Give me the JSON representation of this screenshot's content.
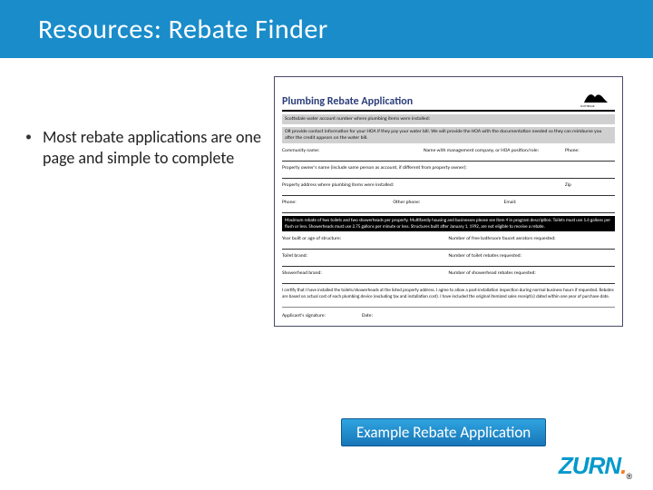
{
  "title": "Resources:  Rebate Finder",
  "bullet": "Most rebate applications are one page and simple to complete",
  "form": {
    "logo_city": "CITY OF SCOTTSDALE",
    "heading": "Plumbing Rebate Application",
    "band1": "Scottsdale water account number where plumbing items were installed:",
    "band2": "OR provide contact information for your HOA if they pay your water bill. We will provide the HOA with the documentation needed so they can reimburse you after the credit appears on the water bill.",
    "row1": {
      "a": "Community name:",
      "b": "Name with management company, or HOA position/role:",
      "c": "Phone:"
    },
    "row2": "Property owner's name (include same person as account, if different from property owner):",
    "row3": {
      "a": "Property address where plumbing items were installed:",
      "b": "Zip"
    },
    "row4": {
      "a": "Phone:",
      "b": "Other phone:",
      "c": "Email:"
    },
    "band3": "Maximum rebate of two toilets and two showerheads per property. Multifamily housing and businesses please see item 4 in program description. Toilets must use 1.6 gallons per flush or less. Showerheads must use 2.75 gallons per minute or less. Structures built after January 1, 1992, are not eligible to receive a rebate.",
    "row5": {
      "a": "Year built or age of structure:",
      "b": "Number of free bathroom faucet aerators requested:"
    },
    "row6": {
      "a": "Toilet brand:",
      "b": "Number of toilet rebates requested:"
    },
    "row7": {
      "a": "Showerhead brand:",
      "b": "Number of showerhead rebates requested:"
    },
    "cert": "I certify that I have installed the toilets/showerheads at the listed property address. I agree to allow a post-installation inspection during normal business hours if requested. Rebates are based on actual cost of each plumbing device (excluding tax and installation cost). I have included the original itemized sales receipt(s) dated within one year of purchase date.",
    "sig": {
      "a": "Applicant's signature:",
      "b": "Date:"
    }
  },
  "caption": "Example Rebate Application",
  "brand": "ZURN"
}
